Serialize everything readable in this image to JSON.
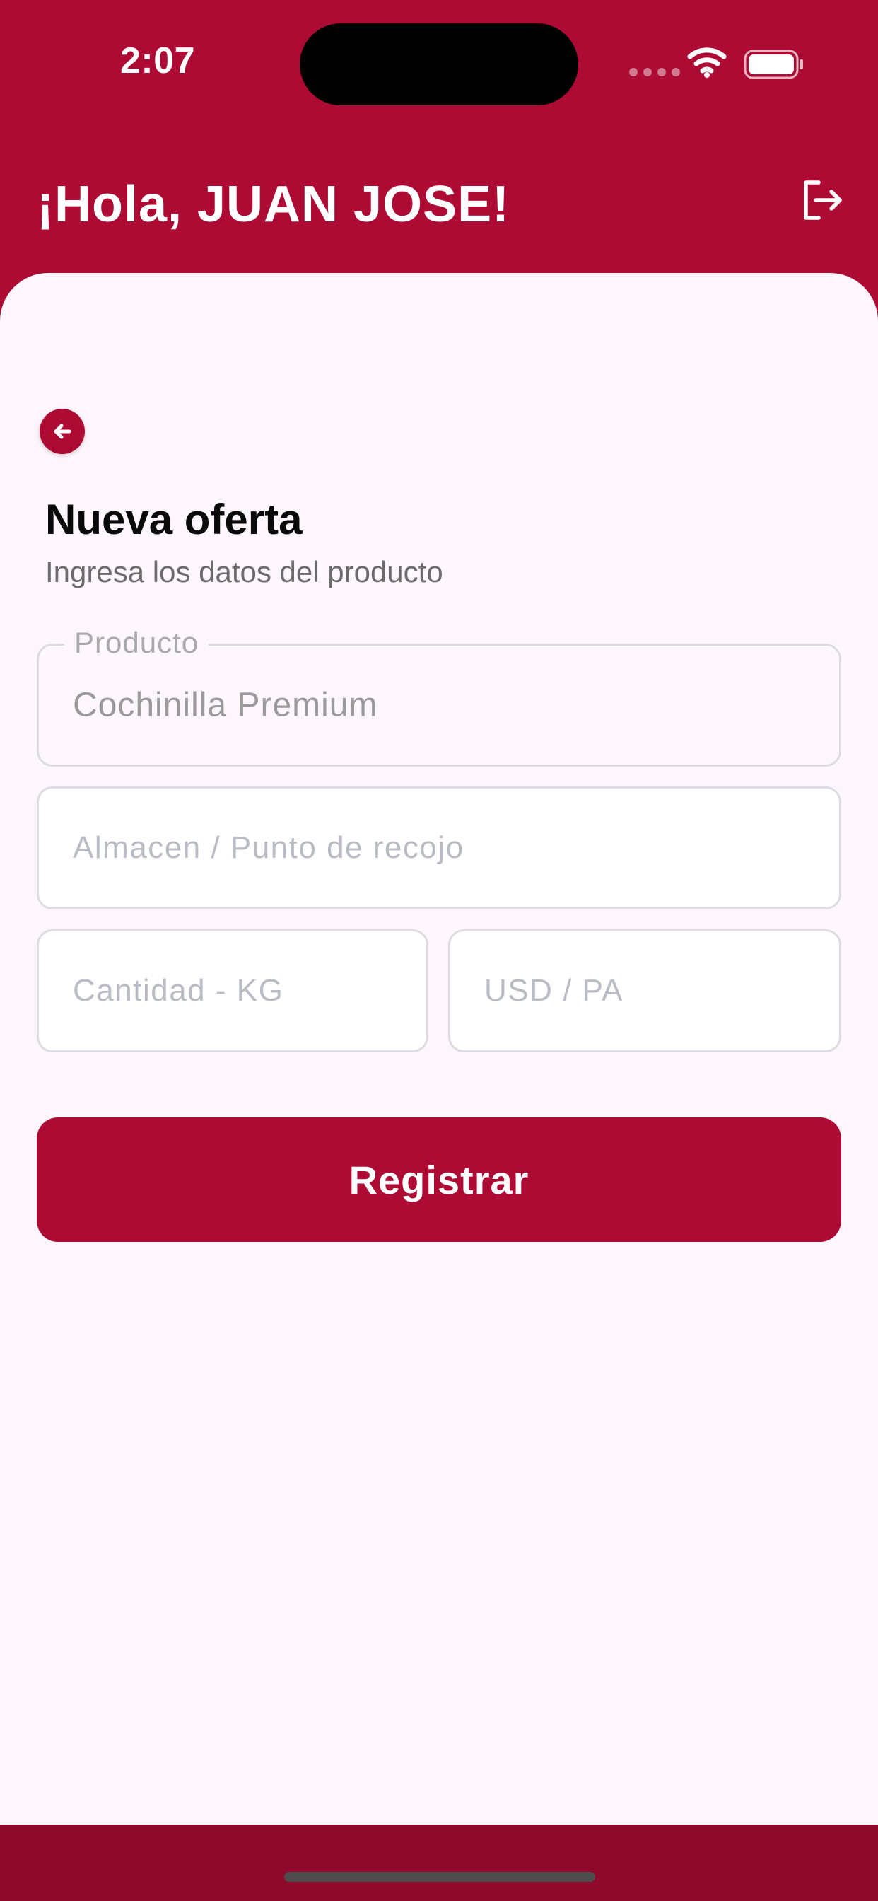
{
  "status_bar": {
    "time": "2:07"
  },
  "header": {
    "greeting": "¡Hola, JUAN JOSE!"
  },
  "form": {
    "title": "Nueva oferta",
    "subtitle": "Ingresa los datos del producto",
    "producto": {
      "label": "Producto",
      "value": "Cochinilla Premium"
    },
    "almacen": {
      "placeholder": "Almacen / Punto de recojo"
    },
    "cantidad": {
      "placeholder": "Cantidad - KG"
    },
    "usd": {
      "placeholder": "USD / PA"
    },
    "submit_label": "Registrar"
  },
  "colors": {
    "brand": "#ad0b33",
    "card_background": "#fdf6fd",
    "placeholder": "#b9bcc5"
  },
  "icons": {
    "logout": "logout-icon",
    "back": "arrow-left-icon",
    "wifi": "wifi-icon",
    "battery": "battery-icon"
  }
}
